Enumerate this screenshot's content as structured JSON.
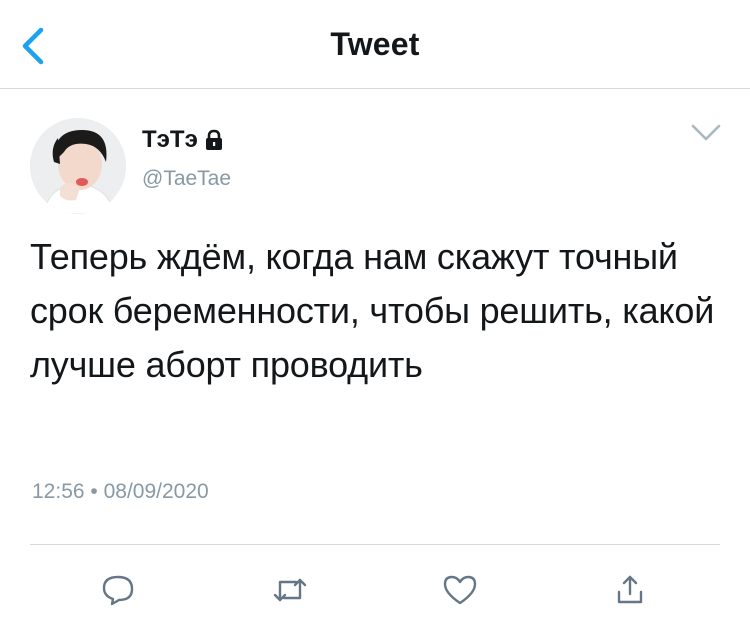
{
  "header": {
    "title": "Tweet"
  },
  "tweet": {
    "display_name": "ТэТэ",
    "handle": "@TaeTae",
    "text": "Теперь ждём, когда нам скажут точный срок беременности, чтобы решить, какой лучше аборт проводить",
    "time": "12:56",
    "separator": "•",
    "date": "08/09/2020"
  },
  "icons": {
    "back": "chevron-left-icon",
    "lock": "lock-icon",
    "more": "chevron-down-icon",
    "actions": [
      "reply-icon",
      "retweet-icon",
      "like-icon",
      "share-icon"
    ]
  },
  "colors": {
    "accent": "#1da1f2",
    "secondary_text": "#8899a6",
    "primary_text": "#14171a",
    "divider": "#d6d9dc"
  }
}
